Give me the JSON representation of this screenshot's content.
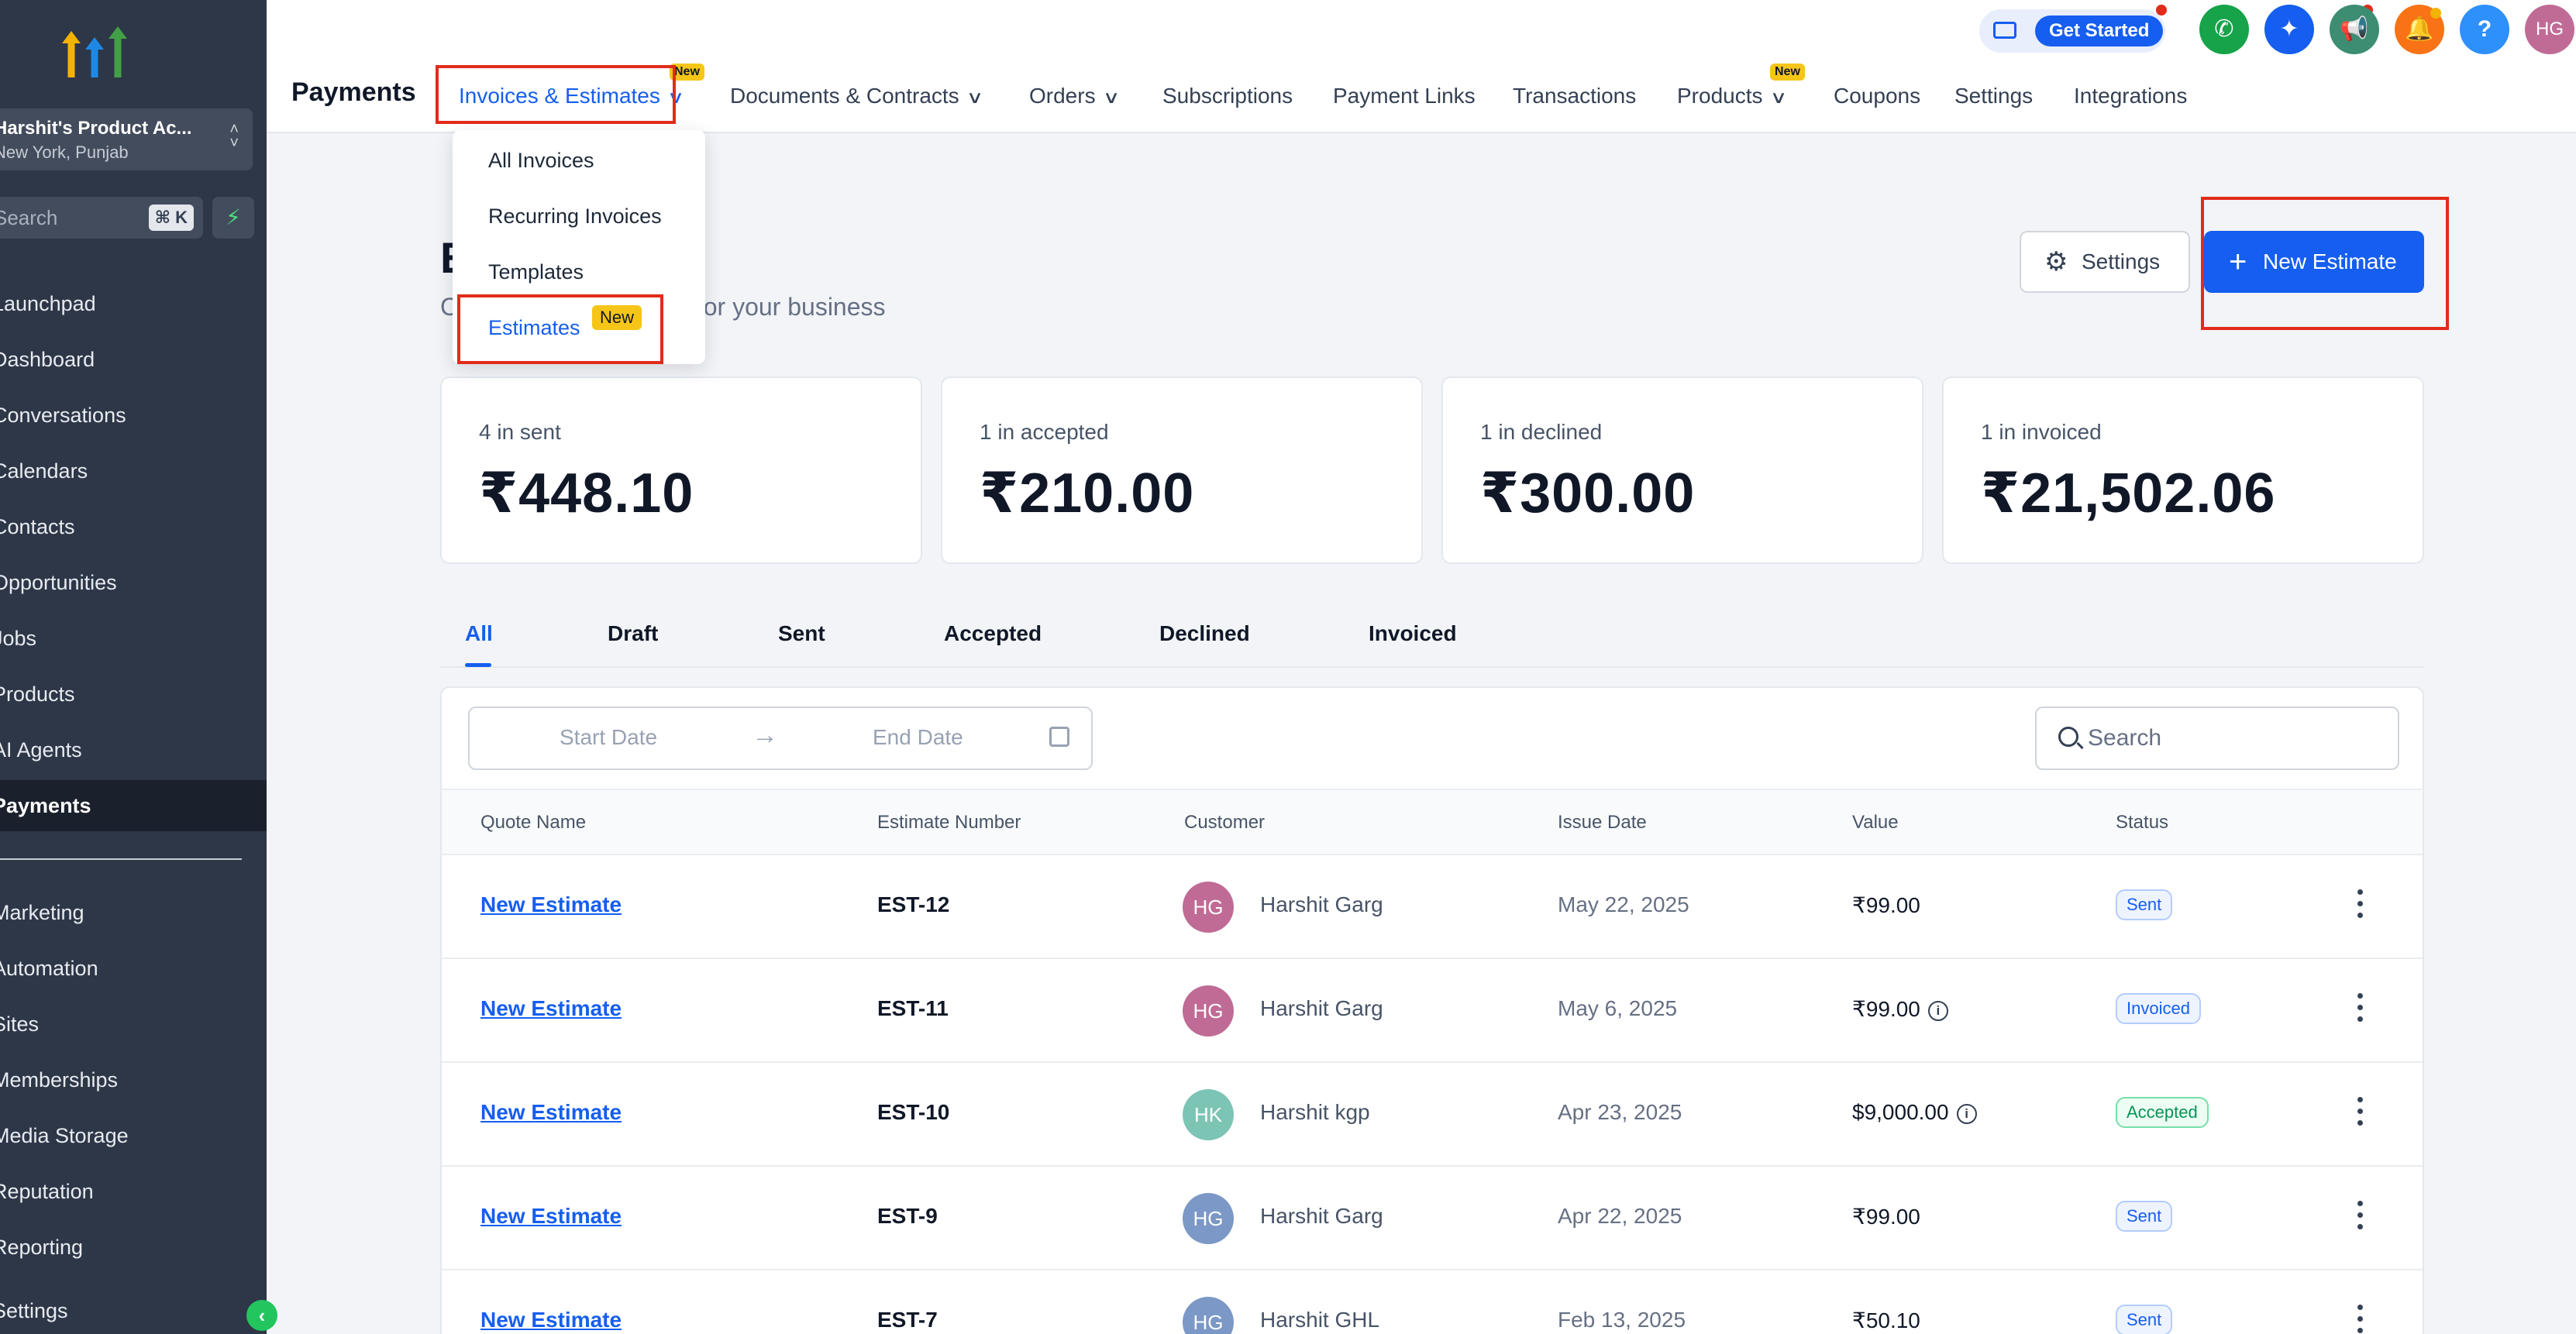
{
  "sidebar": {
    "account": {
      "name": "Harshit's Product Ac...",
      "location": "New York, Punjab"
    },
    "search": {
      "placeholder": "Search",
      "shortcut": "⌘ K"
    },
    "items": [
      {
        "label": "Launchpad"
      },
      {
        "label": "Dashboard"
      },
      {
        "label": "Conversations"
      },
      {
        "label": "Calendars"
      },
      {
        "label": "Contacts"
      },
      {
        "label": "Opportunities"
      },
      {
        "label": "Jobs"
      },
      {
        "label": "Products"
      },
      {
        "label": "AI Agents"
      },
      {
        "label": "Payments"
      },
      {
        "label": "Marketing"
      },
      {
        "label": "Automation"
      },
      {
        "label": "Sites"
      },
      {
        "label": "Memberships"
      },
      {
        "label": "Media Storage"
      },
      {
        "label": "Reputation"
      },
      {
        "label": "Reporting"
      },
      {
        "label": "Settings"
      }
    ]
  },
  "topbar": {
    "title": "Payments",
    "tabs": [
      {
        "label": "Invoices & Estimates",
        "badge": "New"
      },
      {
        "label": "Documents & Contracts"
      },
      {
        "label": "Orders"
      },
      {
        "label": "Subscriptions"
      },
      {
        "label": "Payment Links"
      },
      {
        "label": "Transactions"
      },
      {
        "label": "Products",
        "badge": "New"
      },
      {
        "label": "Coupons"
      },
      {
        "label": "Settings"
      },
      {
        "label": "Integrations"
      }
    ],
    "get_started": "Get Started",
    "user_initials": "HG",
    "help": "?"
  },
  "dropdown": {
    "items": [
      {
        "label": "All Invoices"
      },
      {
        "label": "Recurring Invoices"
      },
      {
        "label": "Templates"
      },
      {
        "label": "Estimates",
        "badge": "New"
      }
    ]
  },
  "main": {
    "heading": "E",
    "subtitle": "C                          estimates generated for your business",
    "settings_label": "Settings",
    "new_label": "New Estimate",
    "stats": [
      {
        "label": "4 in sent",
        "value": "₹448.10"
      },
      {
        "label": "1 in accepted",
        "value": "₹210.00"
      },
      {
        "label": "1 in declined",
        "value": "₹300.00"
      },
      {
        "label": "1 in invoiced",
        "value": "₹21,502.06"
      }
    ],
    "filter_tabs": [
      "All",
      "Draft",
      "Sent",
      "Accepted",
      "Declined",
      "Invoiced"
    ],
    "date_start": "Start Date",
    "date_end": "End Date",
    "search_placeholder": "Search",
    "columns": [
      "Quote Name",
      "Estimate Number",
      "Customer",
      "Issue Date",
      "Value",
      "Status"
    ],
    "rows": [
      {
        "name": "New Estimate",
        "number": "EST-12",
        "initials": "HG",
        "customer": "Harshit Garg",
        "date": "May 22, 2025",
        "value": "₹99.00",
        "info": false,
        "status": "Sent"
      },
      {
        "name": "New Estimate",
        "number": "EST-11",
        "initials": "HG",
        "customer": "Harshit Garg",
        "date": "May 6, 2025",
        "value": "₹99.00",
        "info": true,
        "status": "Invoiced"
      },
      {
        "name": "New Estimate",
        "number": "EST-10",
        "initials": "HK",
        "customer": "Harshit kgp",
        "date": "Apr 23, 2025",
        "value": "$9,000.00",
        "info": true,
        "status": "Accepted"
      },
      {
        "name": "New Estimate",
        "number": "EST-9",
        "initials": "HG",
        "customer": "Harshit Garg",
        "date": "Apr 22, 2025",
        "value": "₹99.00",
        "info": false,
        "status": "Sent"
      },
      {
        "name": "New Estimate",
        "number": "EST-7",
        "initials": "HG",
        "customer": "Harshit GHL",
        "date": "Feb 13, 2025",
        "value": "₹50.10",
        "info": false,
        "status": "Sent"
      }
    ]
  },
  "colors": {
    "accent": "#155eef",
    "highlight_box": "#e22b1b",
    "sidebar_bg": "#2d3748",
    "new_badge": "#f5c518"
  }
}
